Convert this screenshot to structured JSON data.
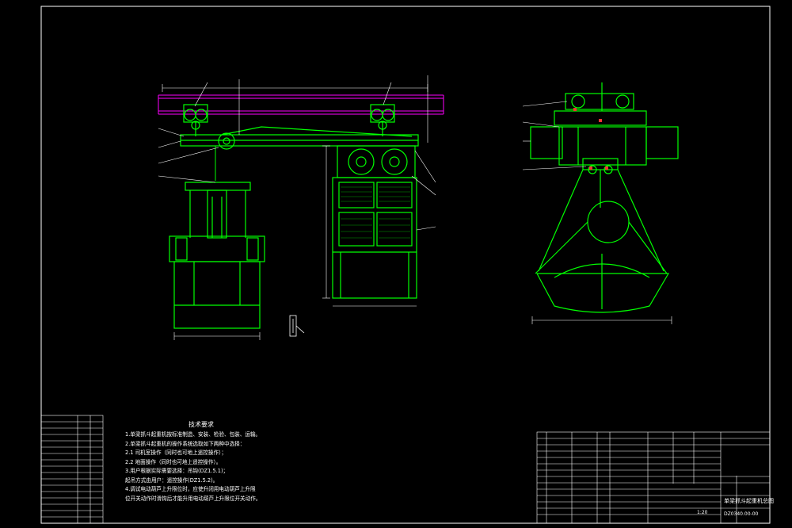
{
  "colors": {
    "background": "#000000",
    "frame": "#ffffff",
    "geometry": "#00ff00",
    "rail": "#ff00ff",
    "dimension": "#ffffff",
    "leader": "#ffffff",
    "callout": "#ff3333"
  },
  "technical_requirements": {
    "title": "技术要求",
    "lines": [
      "1.单梁抓斗起重机按标准制造、安装、检验、包装、运输。",
      "2.单梁抓斗起重机的操作系统选取如下两种中选择：",
      "2.1 司机室操作（同时也可地上遥控操作）；",
      "2.2 地面操作（同时也可地上遥控操作）。",
      "3.用户根据实际需要选择：吊钩(DZ1.5.1)；",
      "  起吊方式由用户：遥控操作(DZ1.5.2)。",
      "4.调试电动葫芦上升限位时，应使升闭用电动葫芦上升限",
      "  位开关动作时滑钩后才能升用电动葫芦上升限位开关动作。"
    ]
  },
  "title_block": {
    "drawing_title": "单梁抓斗起重机总图",
    "drawing_number": "DZ0340.00-00",
    "scale": "1:20"
  }
}
